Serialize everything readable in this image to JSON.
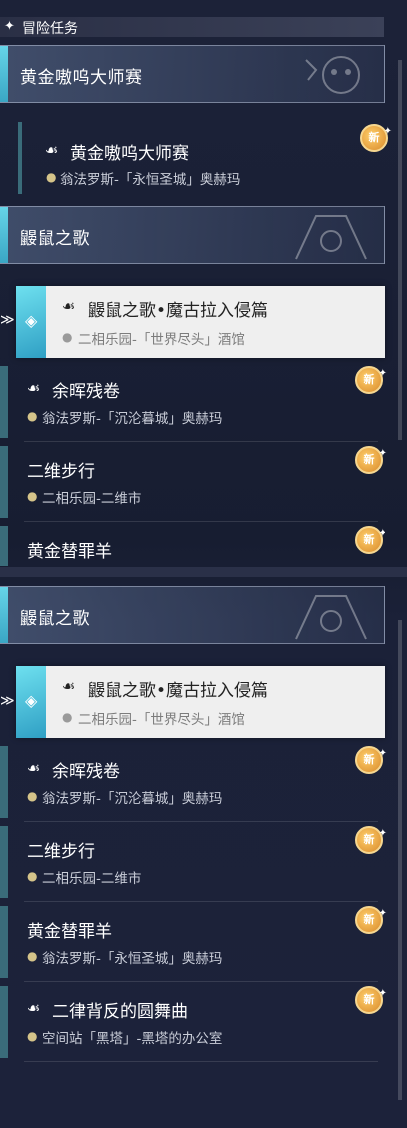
{
  "header": {
    "marker": "✦",
    "title": "冒险任务"
  },
  "quest_icon": "quest-ribbon-icon",
  "pin_icon": "location-pin-icon",
  "badge_label": "新",
  "colors": {
    "accent": "#5fd0e6",
    "badge": "#e7a34a"
  },
  "panel_top": {
    "group1": {
      "name": "黄金嗷呜大师赛"
    },
    "group1_item": {
      "title": "黄金嗷呜大师赛",
      "location": "翁法罗斯-「永恒圣城」奥赫玛"
    },
    "group2": {
      "name": "鼹鼠之歌"
    },
    "selected": {
      "title": "鼹鼠之歌•魔古拉入侵篇",
      "location": "二相乐园-「世界尽头」酒馆"
    },
    "items": [
      {
        "title": "余晖残卷",
        "location": "翁法罗斯-「沉沦暮城」奥赫玛"
      },
      {
        "title": "二维步行",
        "location": "二相乐园-二维市"
      },
      {
        "title": "黄金替罪羊",
        "location": ""
      }
    ]
  },
  "panel_bottom": {
    "group": {
      "name": "鼹鼠之歌"
    },
    "selected": {
      "title": "鼹鼠之歌•魔古拉入侵篇",
      "location": "二相乐园-「世界尽头」酒馆"
    },
    "items": [
      {
        "title": "余晖残卷",
        "location": "翁法罗斯-「沉沦暮城」奥赫玛"
      },
      {
        "title": "二维步行",
        "location": "二相乐园-二维市"
      },
      {
        "title": "黄金替罪羊",
        "location": "翁法罗斯-「永恒圣城」奥赫玛"
      },
      {
        "title": "二律背反的圆舞曲",
        "location": "空间站「黑塔」-黑塔的办公室"
      }
    ]
  }
}
